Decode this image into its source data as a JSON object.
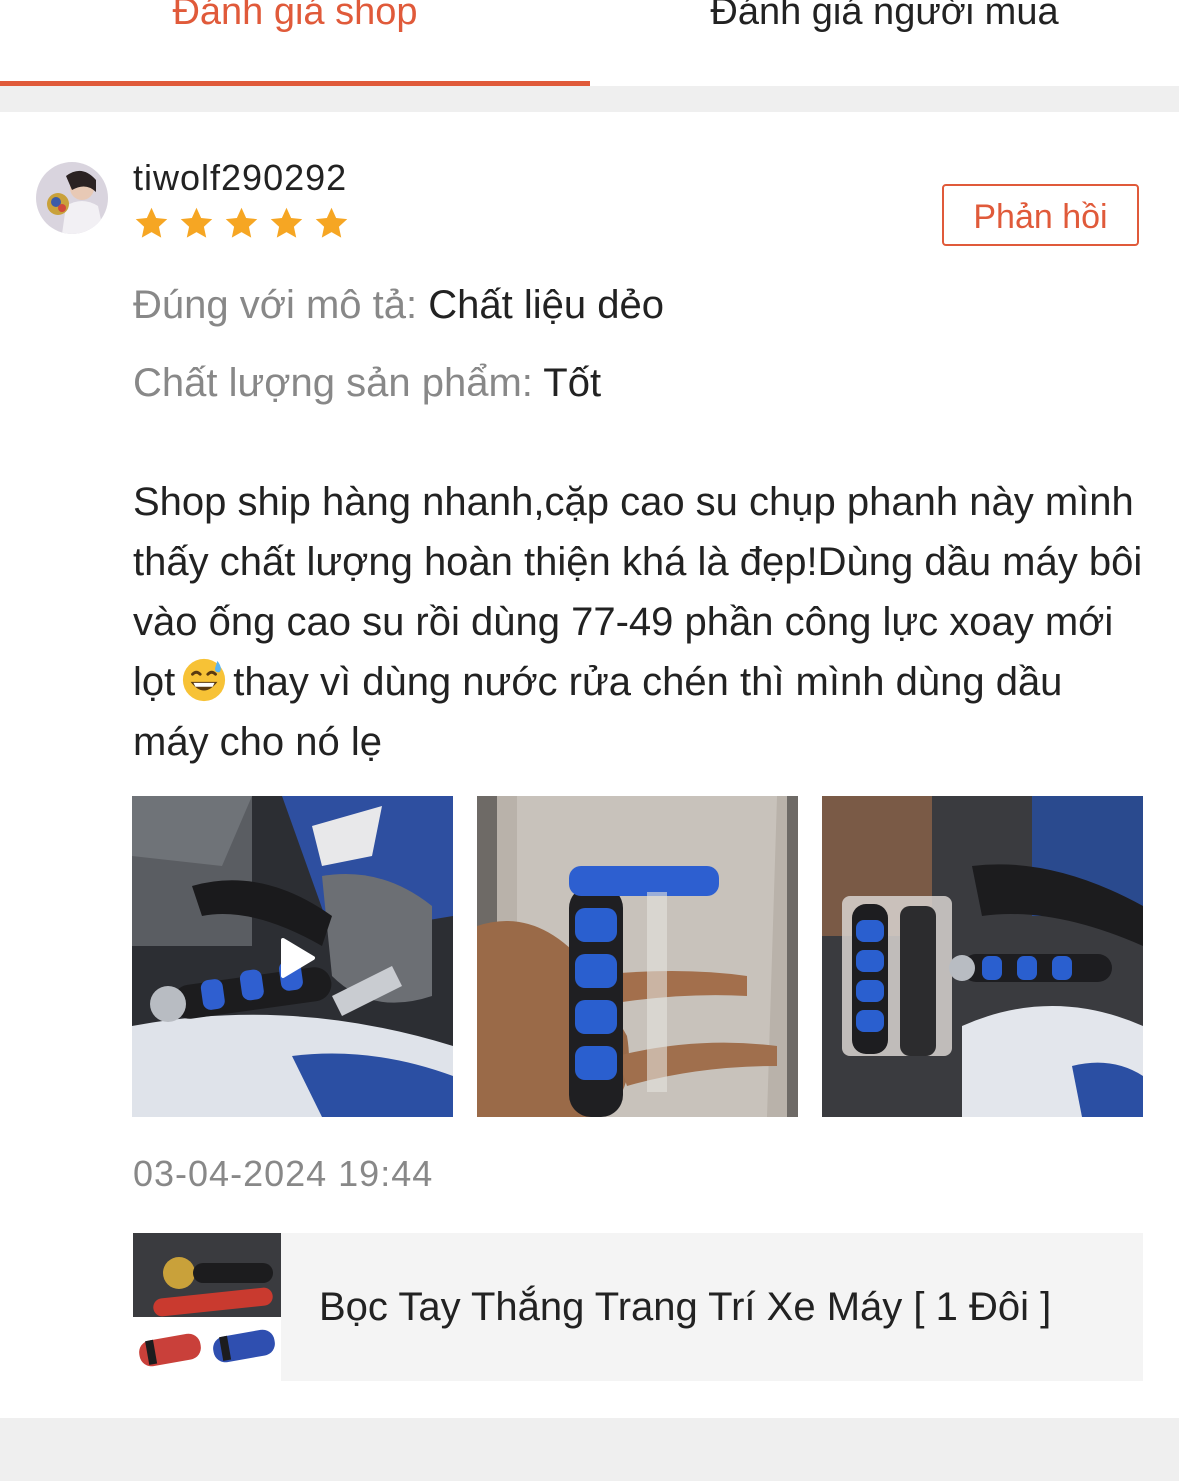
{
  "tabs": {
    "shop": "Đánh giá shop",
    "buyer": "Đánh giá người mua"
  },
  "review": {
    "username": "tiwolf290292",
    "rating": 5,
    "max_rating": 5,
    "reply_label": "Phản hồi",
    "attributes": [
      {
        "label": "Đúng với mô tả:",
        "value": "Chất liệu dẻo"
      },
      {
        "label": "Chất lượng sản phẩm:",
        "value": "Tốt"
      }
    ],
    "comment_part1": "Shop ship hàng nhanh,cặp cao su chụp phanh này mình thấy chất lượng hoàn thiện khá là đẹp!Dùng dầu máy bôi vào ống cao su rồi dùng 77-49 phần công lực xoay mới lọt",
    "comment_emoji": "grinning-sweat-emoji",
    "comment_part2": "thay vì dùng nước rửa chén thì mình dùng dầu máy cho nó lẹ",
    "media": [
      {
        "kind": "video",
        "icon": "play-icon"
      },
      {
        "kind": "image"
      },
      {
        "kind": "image"
      }
    ],
    "timestamp": "03-04-2024 19:44",
    "product": {
      "name": "Bọc Tay Thắng Trang Trí Xe Máy [ 1 Đôi ]"
    }
  },
  "colors": {
    "accent": "#e05a3a",
    "star": "#f6a623",
    "muted_text": "#888888",
    "divider_bg": "#efefef"
  }
}
